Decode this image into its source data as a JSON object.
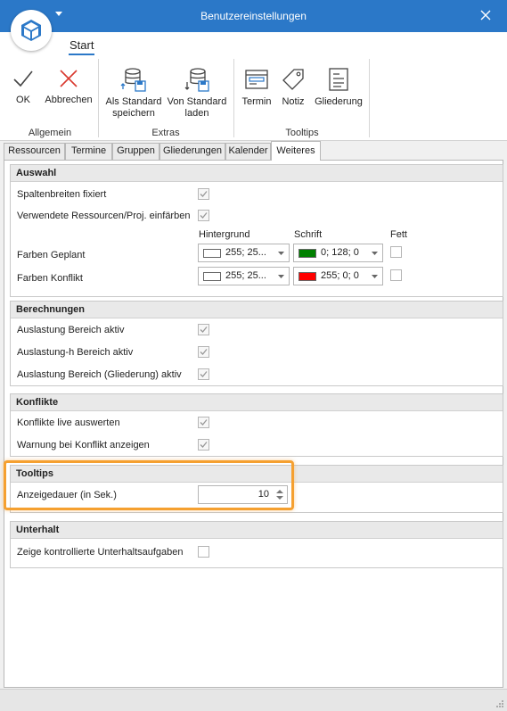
{
  "window": {
    "title": "Benutzereinstellungen"
  },
  "ribbon": {
    "active_tab": "Start",
    "groups": {
      "allgemein": {
        "label": "Allgemein",
        "ok": "OK",
        "abbrechen": "Abbrechen"
      },
      "extras": {
        "label": "Extras",
        "save_l1": "Als Standard",
        "save_l2": "speichern",
        "load_l1": "Von Standard",
        "load_l2": "laden"
      },
      "tooltips": {
        "label": "Tooltips",
        "termin": "Termin",
        "notiz": "Notiz",
        "gliederung": "Gliederung"
      }
    }
  },
  "tabs": [
    "Ressourcen",
    "Termine",
    "Gruppen",
    "Gliederungen",
    "Kalender",
    "Weiteres"
  ],
  "active_tab_index": 5,
  "sections": {
    "auswahl": {
      "title": "Auswahl",
      "spaltenbreiten": "Spaltenbreiten fixiert",
      "ressourcen": "Verwendete Ressourcen/Proj. einfärben",
      "col_hintergrund": "Hintergrund",
      "col_schrift": "Schrift",
      "col_fett": "Fett",
      "geplant": {
        "label": "Farben Geplant",
        "bg_value": "255; 25...",
        "bg_color": "#ffffff",
        "fg_value": "0; 128; 0",
        "fg_color": "#008000"
      },
      "konflikt": {
        "label": "Farben Konflikt",
        "bg_value": "255; 25...",
        "bg_color": "#ffffff",
        "fg_value": "255; 0; 0",
        "fg_color": "#ff0000"
      }
    },
    "berechnungen": {
      "title": "Berechnungen",
      "r1": "Auslastung Bereich aktiv",
      "r2": "Auslastung-h Bereich aktiv",
      "r3": "Auslastung Bereich (Gliederung) aktiv"
    },
    "konflikte": {
      "title": "Konflikte",
      "r1": "Konflikte live auswerten",
      "r2": "Warnung bei Konflikt anzeigen"
    },
    "tooltips": {
      "title": "Tooltips",
      "anzeigedauer": "Anzeigedauer (in Sek.)",
      "anzeigedauer_value": "10"
    },
    "unterhalt": {
      "title": "Unterhalt",
      "r1": "Zeige kontrollierte Unterhaltsaufgaben"
    }
  },
  "colors": {
    "accent": "#2b78c8",
    "highlight": "#f5a030"
  }
}
